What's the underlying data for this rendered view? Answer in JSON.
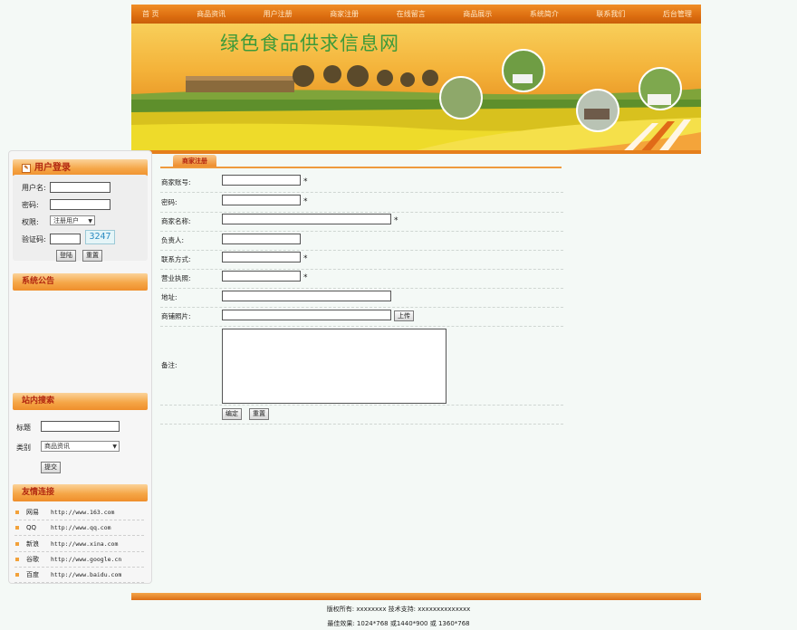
{
  "nav": {
    "items": [
      "首 页",
      "商品资讯",
      "用户注册",
      "商家注册",
      "在线留言",
      "商品展示",
      "系统简介",
      "联系我们",
      "后台管理"
    ]
  },
  "banner": {
    "title": "绿色食品供求信息网"
  },
  "login": {
    "title": "用户登录",
    "username_label": "用户名:",
    "username_value": "",
    "password_label": "密码:",
    "password_value": "",
    "role_label": "权限:",
    "role_value": "注册用户",
    "captcha_label": "验证码:",
    "captcha_value": "",
    "captcha_code": "3247",
    "login_button": "登陆",
    "reset_button": "重置"
  },
  "notice": {
    "title": "系统公告"
  },
  "search": {
    "title": "站内搜索",
    "keyword_label": "标题",
    "keyword_value": "",
    "category_label": "类别",
    "category_value": "商品资讯",
    "submit_button": "提交"
  },
  "links": {
    "title": "友情连接",
    "items": [
      {
        "name": "网易",
        "url": "http://www.163.com"
      },
      {
        "name": "QQ",
        "url": "http://www.qq.com"
      },
      {
        "name": "新浪",
        "url": "http://www.xina.com"
      },
      {
        "name": "谷歌",
        "url": "http://www.google.cn"
      },
      {
        "name": "百度",
        "url": "http://www.baidu.com"
      }
    ]
  },
  "form": {
    "tab_label": "商家注册",
    "fields": {
      "account": {
        "label": "商家账号:",
        "value": "",
        "required_mark": "*"
      },
      "password": {
        "label": "密码:",
        "value": "",
        "required_mark": "*"
      },
      "name": {
        "label": "商家名称:",
        "value": "",
        "required_mark": "*"
      },
      "owner": {
        "label": "负责人:",
        "value": ""
      },
      "contact": {
        "label": "联系方式:",
        "value": "",
        "required_mark": "*"
      },
      "license": {
        "label": "营业执照:",
        "value": "",
        "required_mark": "*"
      },
      "address": {
        "label": "地址:",
        "value": ""
      },
      "photo": {
        "label": "商铺照片:",
        "value": "",
        "upload_button": "上传"
      },
      "notes": {
        "label": "备注:",
        "value": ""
      }
    },
    "edit_button": "编定",
    "reset_button": "重置"
  },
  "footer": {
    "copyright": "版权所有: xxxxxxxx  技术支持: xxxxxxxxxxxxxx",
    "resolution": "最佳效果: 1024*768 或1440*900 或 1360*768"
  },
  "colors": {
    "nav_orange": "#dd6e10",
    "title_green": "#3d9a39",
    "title_red": "#b2270f"
  }
}
